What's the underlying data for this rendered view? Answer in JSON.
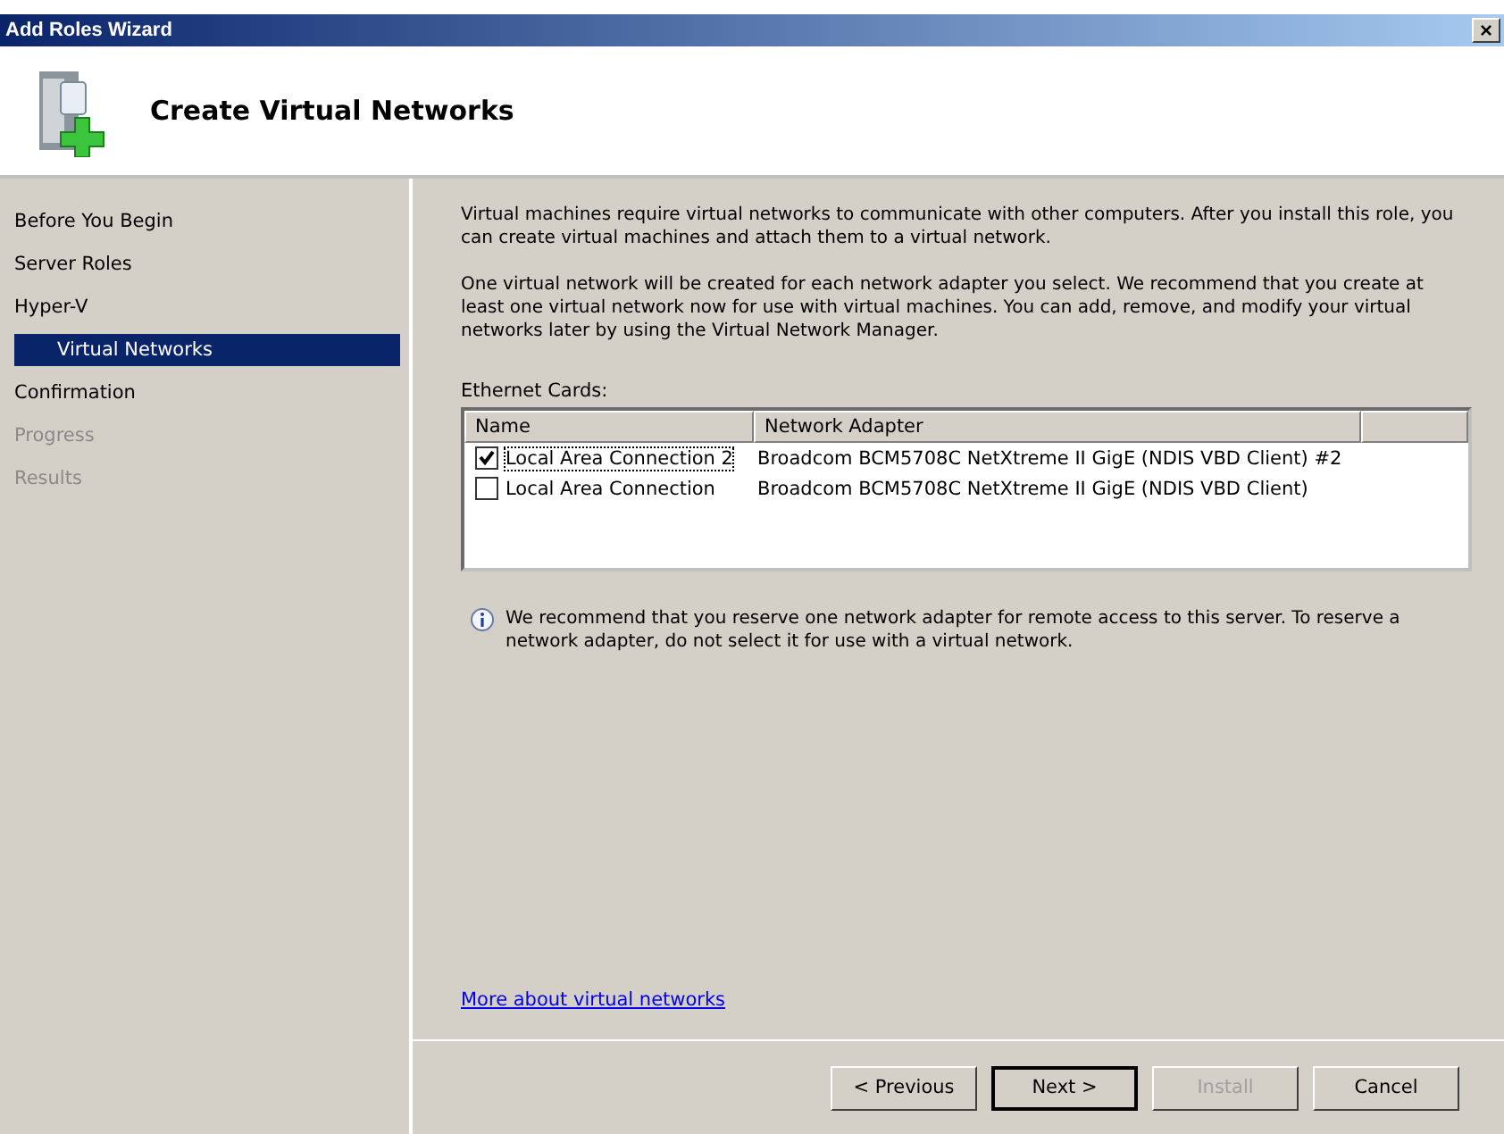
{
  "window": {
    "title": "Add Roles Wizard",
    "close": "×"
  },
  "header": {
    "title": "Create Virtual Networks"
  },
  "sidebar": {
    "items": [
      {
        "label": "Before You Begin",
        "selected": false,
        "disabled": false
      },
      {
        "label": "Server Roles",
        "selected": false,
        "disabled": false
      },
      {
        "label": "Hyper-V",
        "selected": false,
        "disabled": false,
        "children": [
          {
            "label": "Virtual Networks",
            "selected": true,
            "disabled": false
          }
        ]
      },
      {
        "label": "Confirmation",
        "selected": false,
        "disabled": false
      },
      {
        "label": "Progress",
        "selected": false,
        "disabled": true
      },
      {
        "label": "Results",
        "selected": false,
        "disabled": true
      }
    ]
  },
  "content": {
    "paragraphs": [
      "Virtual machines require virtual networks to communicate with other computers. After you install this role, you can create virtual machines and attach them to a virtual network.",
      "One virtual network will be created for each network adapter you select. We recommend that you create at least one virtual network now for use with virtual machines. You can add, remove, and modify your virtual networks later by using the Virtual Network Manager."
    ],
    "list_label": "Ethernet Cards:",
    "table": {
      "columns": [
        "Name",
        "Network Adapter"
      ],
      "rows": [
        {
          "name": "Local Area Connection 2",
          "adapter": "Broadcom BCM5708C NetXtreme II GigE (NDIS VBD Client) #2",
          "checked": true,
          "focused": true
        },
        {
          "name": "Local Area Connection",
          "adapter": "Broadcom BCM5708C NetXtreme II GigE (NDIS VBD Client)",
          "checked": false,
          "focused": false
        }
      ]
    },
    "info": "We recommend that you reserve one network adapter for remote access to this server. To reserve a network adapter, do not select it for use with a virtual network.",
    "link": "More about virtual networks"
  },
  "buttons": [
    {
      "label": "< Previous",
      "disabled": false,
      "default": false
    },
    {
      "label": "Next >",
      "disabled": false,
      "default": true
    },
    {
      "label": "Install",
      "disabled": true,
      "default": false
    },
    {
      "label": "Cancel",
      "disabled": false,
      "default": false
    }
  ]
}
